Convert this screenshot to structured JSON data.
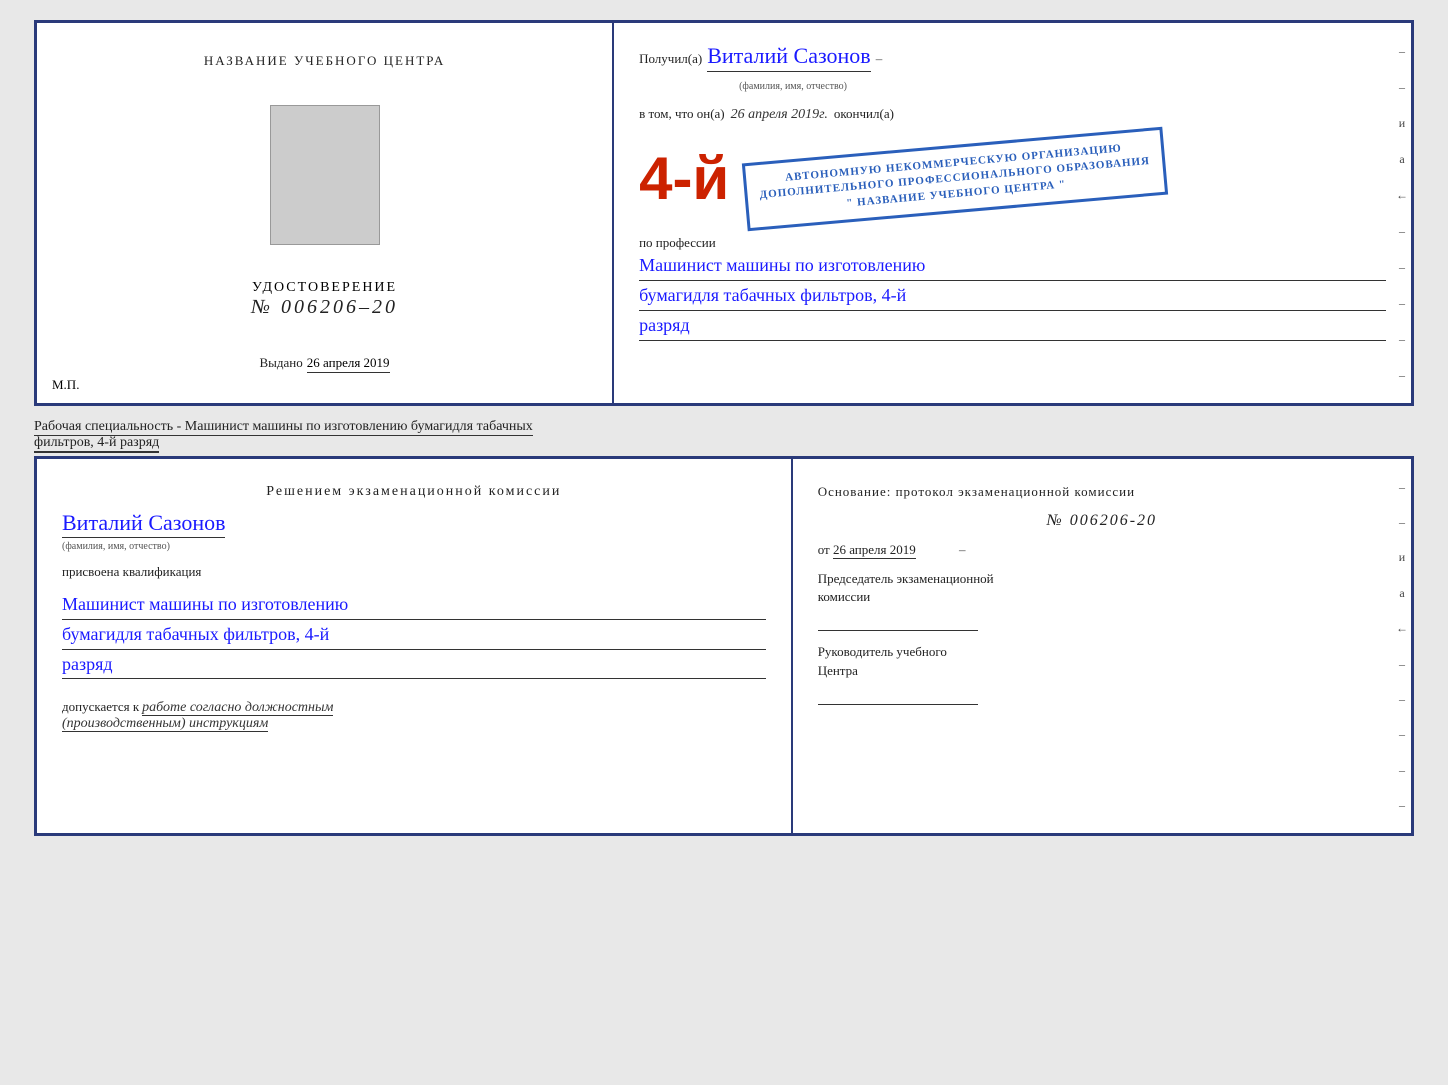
{
  "top_cert": {
    "left": {
      "title": "НАЗВАНИЕ УЧЕБНОГО ЦЕНТРА",
      "udost_label": "УДОСТОВЕРЕНИЕ",
      "udost_number": "№ 006206–20",
      "issued_label": "Выдано",
      "issued_date": "26 апреля 2019",
      "mp_label": "М.П."
    },
    "right": {
      "received_label": "Получил(а)",
      "recipient_name": "Виталий Сазонов",
      "recipient_sub": "(фамилия, имя, отчество)",
      "in_that_label": "в том, что он(а)",
      "date_text": "26 апреля 2019г.",
      "okончил_label": "окончил(а)",
      "number_big": "4-й",
      "org_line1": "АВТОНОМНУЮ НЕКОММЕРЧЕСКУЮ ОРГАНИЗАЦИЮ",
      "org_line2": "ДОПОЛНИТЕЛЬНОГО ПРОФЕССИОНАЛЬНОГО ОБРАЗОВАНИЯ",
      "org_line3": "\" НАЗВАНИЕ УЧЕБНОГО ЦЕНТРА \"",
      "profession_label": "по профессии",
      "profession_hand1": "Машинист машины по изготовлению",
      "profession_hand2": "бумагидля табачных фильтров, 4-й",
      "profession_hand3": "разряд",
      "dashes": [
        "–",
        "–",
        "и",
        "а",
        "←",
        "–",
        "–",
        "–",
        "–",
        "–"
      ]
    }
  },
  "middle_label": {
    "text": "Рабочая специальность - Машинист машины по изготовлению бумагидля табачных",
    "text2_underline": "фильтров, 4-й разряд"
  },
  "bottom_cert": {
    "left": {
      "decision_title": "Решением  экзаменационной  комиссии",
      "person_name": "Виталий Сазонов",
      "person_sub": "(фамилия, имя, отчество)",
      "assigned_label": "присвоена квалификация",
      "qualification_hand1": "Машинист машины по изготовлению",
      "qualification_hand2": "бумагидля табачных фильтров, 4-й",
      "qualification_hand3": "разряд",
      "allowed_label": "допускается к",
      "allowed_hand": "работе согласно должностным",
      "allowed_hand2": "(производственным) инструкциям"
    },
    "right": {
      "basis_label": "Основание: протокол экзаменационной  комиссии",
      "protocol_number": "№  006206-20",
      "date_from": "от",
      "date_value": "26 апреля 2019",
      "chairman_label": "Председатель экзаменационной",
      "chairman_label2": "комиссии",
      "head_label": "Руководитель учебного",
      "head_label2": "Центра",
      "dashes": [
        "–",
        "–",
        "–",
        "и",
        "а",
        "←",
        "–",
        "–",
        "–",
        "–"
      ]
    }
  }
}
